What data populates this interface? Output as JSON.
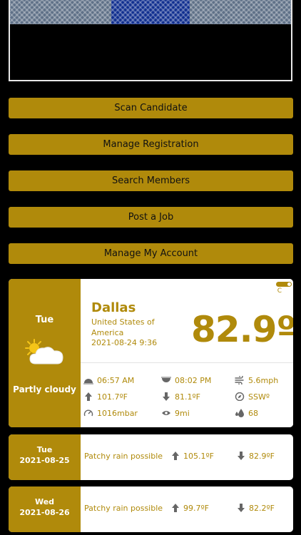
{
  "buttons": {
    "scan": "Scan Candidate",
    "manage_registration": "Manage Registration",
    "search_members": "Search Members",
    "post_job": "Post a Job",
    "manage_account": "Manage My Account"
  },
  "weather": {
    "day": "Tue",
    "condition": "Partly cloudy",
    "unit_label": "C",
    "city": "Dallas",
    "country": "United States of America",
    "datetime": "2021-08-24 9:36",
    "temperature": "82.9º",
    "temp_unit": "F",
    "sunrise": "06:57 AM",
    "sunset": "08:02 PM",
    "wind_speed": "5.6mph",
    "high": "101.7ºF",
    "low": "81.1ºF",
    "wind_dir": "SSWº",
    "pressure": "1016mbar",
    "visibility": "9mi",
    "humidity": "68"
  },
  "forecast": [
    {
      "day": "Tue",
      "date": "2021-08-25",
      "description": "Patchy rain possible",
      "high": "105.1ºF",
      "low": "82.9ºF"
    },
    {
      "day": "Wed",
      "date": "2021-08-26",
      "description": "Patchy rain possible",
      "high": "99.7ºF",
      "low": "82.2ºF"
    }
  ],
  "colors": {
    "accent": "#b08a0b",
    "background": "#000000",
    "card": "#ffffff"
  }
}
